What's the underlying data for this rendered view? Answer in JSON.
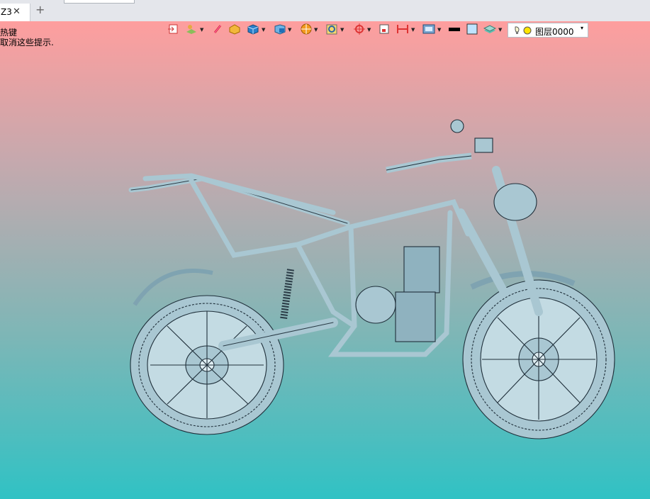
{
  "tab": {
    "label": "Z3",
    "close": "✕",
    "add": "+"
  },
  "hints": {
    "line1": "热键",
    "line2": "取消这些提示."
  },
  "toolbar": {
    "icons": [
      "exit-icon",
      "layer-manager-icon",
      "pencil-icon",
      "box-shape-icon",
      "cube-icon",
      "view-cube-icon",
      "sphere-render-icon",
      "zoom-fit-icon",
      "pick-filter-icon",
      "frame-icon",
      "dimension-icon",
      "display-mode-icon",
      "line-color-icon",
      "fill-color-icon",
      "layer-stack-icon"
    ],
    "layer_value": "图层0000",
    "layer_arrow": "▾"
  },
  "viewport": {
    "gradient_top": "#fe9e9e",
    "gradient_bottom": "#30c2c4",
    "model_color": "#a9c7d2"
  }
}
